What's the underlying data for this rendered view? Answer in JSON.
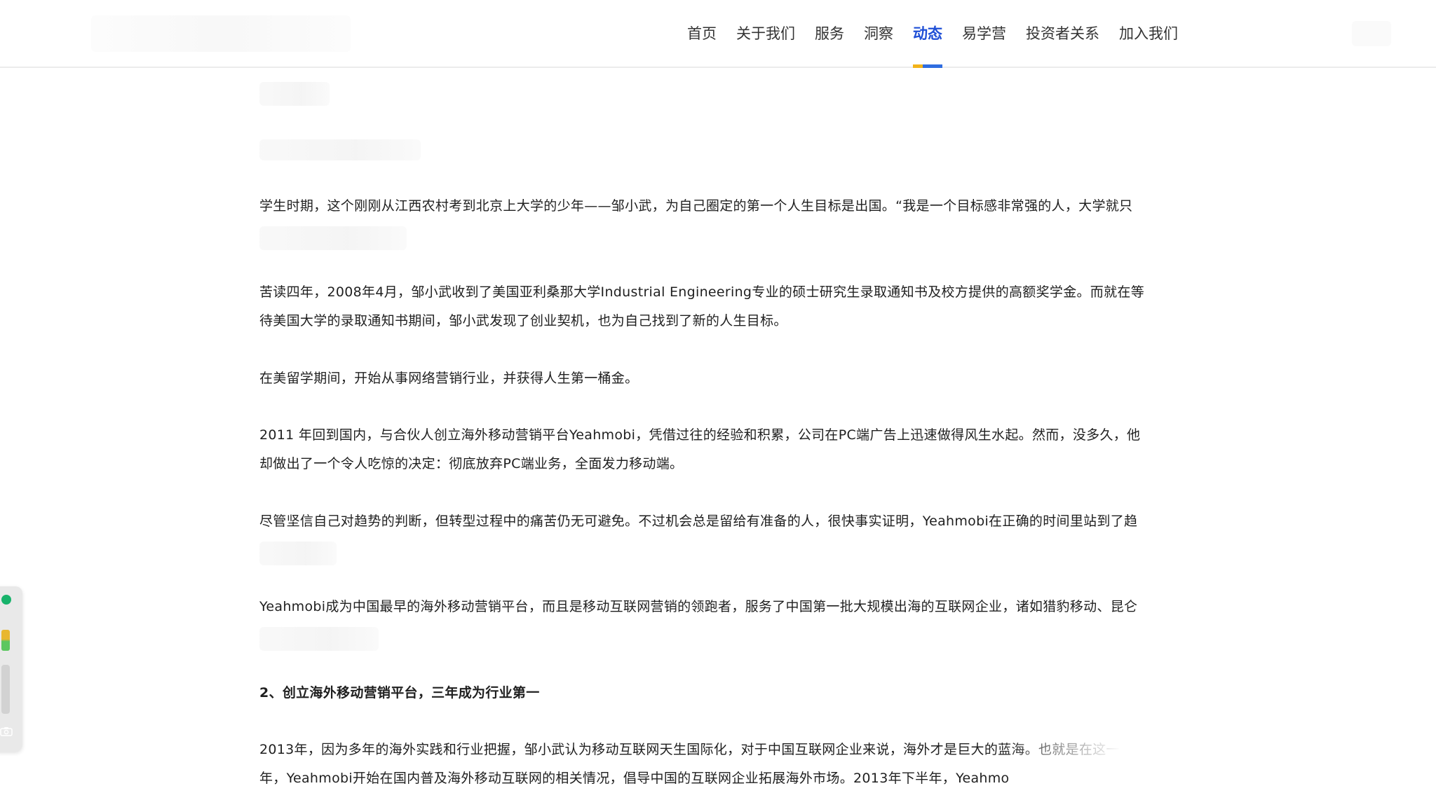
{
  "nav": {
    "items": [
      {
        "label": "首页"
      },
      {
        "label": "关于我们"
      },
      {
        "label": "服务"
      },
      {
        "label": "洞察"
      },
      {
        "label": "动态",
        "active": true
      },
      {
        "label": "易学营"
      },
      {
        "label": "投资者关系"
      },
      {
        "label": "加入我们"
      }
    ]
  },
  "colors": {
    "nav_active": "#1f4fd6",
    "underline_yellow": "#f3b319",
    "underline_blue": "#2f6de0",
    "widget_green": "#18b36b"
  },
  "article": {
    "paragraphs": [
      {
        "lines": [
          "学生时期，这个刚刚从江西农村考到北京上大学的少年——邹小武，为自己圈定的第一个人生目标是出国。“我是一个目标感非常强的人，大学就只"
        ]
      },
      {
        "lines": [
          "苦读四年，2008年4月，邹小武收到了美国亚利桑那大学Industrial Engineering专业的硕士研究生录取通知书及校方提供的高额奖学金。而就在等",
          "待美国大学的录取通知书期间，邹小武发现了创业契机，也为自己找到了新的人生目标。"
        ]
      },
      {
        "lines": [
          "在美留学期间，开始从事网络营销行业，并获得人生第一桶金。"
        ]
      },
      {
        "lines": [
          "2011 年回到国内，与合伙人创立海外移动营销平台Yeahmobi，凭借过往的经验和积累，公司在PC端广告上迅速做得风生水起。然而，没多久，他",
          "却做出了一个令人吃惊的决定：彻底放弃PC端业务，全面发力移动端。"
        ]
      },
      {
        "lines": [
          "尽管坚信自己对趋势的判断，但转型过程中的痛苦仍无可避免。不过机会总是留给有准备的人，很快事实证明，Yeahmobi在正确的时间里站到了趋"
        ]
      },
      {
        "lines": [
          "Yeahmobi成为中国最早的海外移动营销平台，而且是移动互联网营销的领跑者，服务了中国第一批大规模出海的互联网企业，诸如猎豹移动、昆仑"
        ]
      },
      {
        "lines": [
          "2、创立海外移动营销平台，三年成为行业第一"
        ]
      },
      {
        "lines": [
          "2013年，因为多年的海外实践和行业把握，邹小武认为移动互联网天生国际化，对于中国互联网企业来说，海外才是巨大的蓝海。也就是在这一",
          "年，Yeahmobi开始在国内普及海外移动互联网的相关情况，倡导中国的互联网企业拓展海外市场。2013年下半年，Yeahmo"
        ]
      }
    ]
  },
  "side_widget": {
    "icons": [
      "status-dot-icon",
      "level-bar-icon",
      "scroll-track-icon",
      "camera-icon"
    ],
    "camera_glyph": "⌂"
  }
}
